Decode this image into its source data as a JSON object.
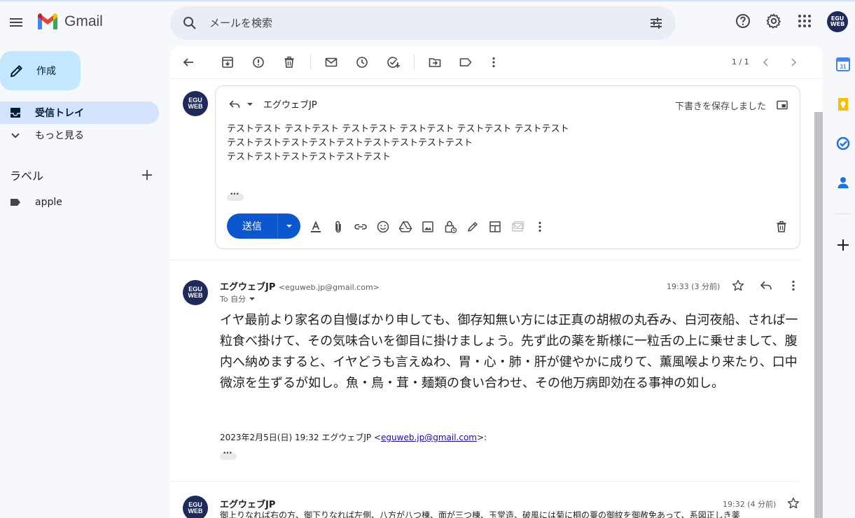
{
  "app": {
    "name": "Gmail"
  },
  "search": {
    "placeholder": "メールを検索"
  },
  "avatar_text": "EGU WEB",
  "nav": {
    "compose_label": "作成",
    "inbox_label": "受信トレイ",
    "more_label": "もっと見る",
    "labels_heading": "ラベル",
    "label_items": [
      "apple"
    ]
  },
  "toolbar": {
    "pager": "1 / 1"
  },
  "draft": {
    "recipient": "エグウェブJP",
    "saved_status": "下書きを保存しました",
    "body_lines": [
      "テストテスト テストテスト テストテスト テストテスト テストテスト テストテスト",
      "テストテストテストテストテストテストテストテストテスト",
      "テストテストテストテストテストテスト"
    ],
    "send_label": "送信"
  },
  "message1": {
    "sender_name": "エグウェブJP",
    "sender_email": "<eguweb.jp@gmail.com>",
    "to": "To 自分",
    "time": "19:33 (3 分前)",
    "body": "イヤ最前より家名の自慢ばかり申しても、御存知無い方には正真の胡椒の丸呑み、白河夜船、されば一粒食べ掛けて、その気味合いを御目に掛けましょう。先ず此の薬を斯様に一粒舌の上に乗せまして、腹内へ納めますると、イヤどうも言えぬわ、胃・心・肺・肝が健やかに成りて、薫風喉より来たり、口中微涼を生ずるが如し。魚・鳥・茸・麺類の食い合わせ、その他万病即効在る事神の如し。",
    "quote_prefix": "2023年2月5日(日) 19:32 エグウェブJP <",
    "quote_email": "eguweb.jp@gmail.com",
    "quote_suffix": ">:"
  },
  "message2": {
    "sender_name": "エグウェブJP",
    "time": "19:32 (4 分前)",
    "snippet": "御上りなれば右の方、御下りなれば左側、八方が八つ棟、面が三つ棟、玉堂造、破風には菊に桐の薹の御紋を御赦免あって、系図正しき薬"
  },
  "colors": {
    "compose_bg": "#c2e7ff",
    "inbox_active_bg": "#d3e3fd",
    "send_button": "#0b57d0",
    "app_bg": "#f6f8fc"
  },
  "icons": {
    "menu": "hamburger-icon",
    "search": "search-icon",
    "tune": "tune-icon",
    "help": "help-icon",
    "settings": "gear-icon",
    "apps": "apps-grid-icon"
  }
}
